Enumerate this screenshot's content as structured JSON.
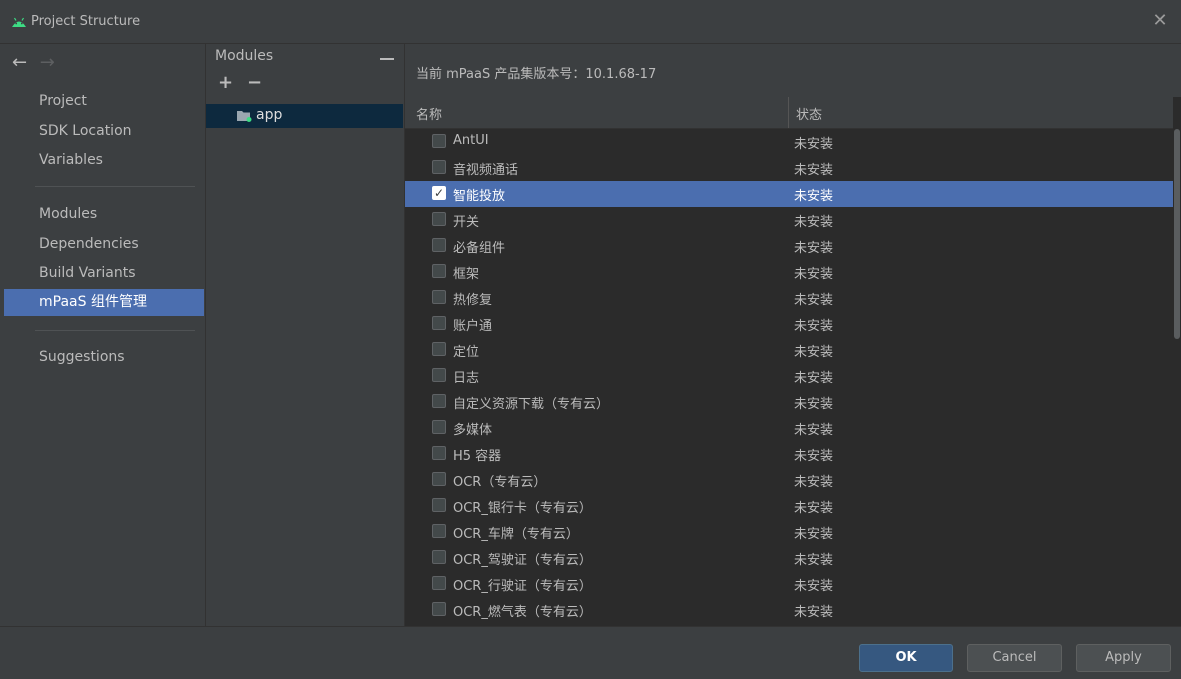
{
  "window": {
    "title": "Project Structure",
    "close_glyph": "✕",
    "logo_icon": "android-icon"
  },
  "nav": {
    "back_glyph": "←",
    "forward_glyph": "→",
    "items": [
      {
        "label": "Project"
      },
      {
        "label": "SDK Location"
      },
      {
        "label": "Variables"
      },
      {
        "label": "Modules"
      },
      {
        "label": "Dependencies"
      },
      {
        "label": "Build Variants"
      },
      {
        "label": "mPaaS 组件管理",
        "selected": true
      },
      {
        "label": "Suggestions"
      }
    ]
  },
  "modules": {
    "title": "Modules",
    "add_glyph": "+",
    "remove_glyph": "−",
    "items": [
      {
        "name": "app",
        "icon": "module-folder-icon"
      }
    ]
  },
  "main": {
    "version_label": "当前 mPaaS 产品集版本号：10.1.68-17",
    "columns": {
      "name": "名称",
      "status": "状态"
    },
    "rows": [
      {
        "name": "AntUI",
        "status": "未安装",
        "checked": false
      },
      {
        "name": "音视频通话",
        "status": "未安装",
        "checked": false
      },
      {
        "name": "智能投放",
        "status": "未安装",
        "checked": true,
        "selected": true
      },
      {
        "name": "开关",
        "status": "未安装",
        "checked": false
      },
      {
        "name": "必备组件",
        "status": "未安装",
        "checked": false
      },
      {
        "name": "框架",
        "status": "未安装",
        "checked": false
      },
      {
        "name": "热修复",
        "status": "未安装",
        "checked": false
      },
      {
        "name": "账户通",
        "status": "未安装",
        "checked": false
      },
      {
        "name": "定位",
        "status": "未安装",
        "checked": false
      },
      {
        "name": "日志",
        "status": "未安装",
        "checked": false
      },
      {
        "name": "自定义资源下载（专有云）",
        "status": "未安装",
        "checked": false
      },
      {
        "name": "多媒体",
        "status": "未安装",
        "checked": false
      },
      {
        "name": "H5 容器",
        "status": "未安装",
        "checked": false
      },
      {
        "name": "OCR（专有云）",
        "status": "未安装",
        "checked": false
      },
      {
        "name": "OCR_银行卡（专有云）",
        "status": "未安装",
        "checked": false
      },
      {
        "name": "OCR_车牌（专有云）",
        "status": "未安装",
        "checked": false
      },
      {
        "name": "OCR_驾驶证（专有云）",
        "status": "未安装",
        "checked": false
      },
      {
        "name": "OCR_行驶证（专有云）",
        "status": "未安装",
        "checked": false
      },
      {
        "name": "OCR_燃气表（专有云）",
        "status": "未安装",
        "checked": false
      }
    ],
    "check_glyph": "✓"
  },
  "buttons": {
    "ok": "OK",
    "cancel": "Cancel",
    "apply": "Apply"
  },
  "colors": {
    "background": "#3c3f41",
    "table_background": "#2b2b2b",
    "selection": "#4b6eaf",
    "module_selection": "#0d293e",
    "ok_button": "#365880"
  }
}
